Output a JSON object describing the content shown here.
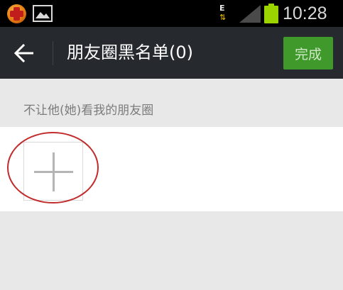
{
  "status_bar": {
    "time": "10:28",
    "data_indicator": "E",
    "icons": [
      "app-notification-icon",
      "gallery-icon",
      "data-transfer-icon",
      "signal-icon",
      "battery-icon"
    ]
  },
  "header": {
    "title": "朋友圈黑名单(0)",
    "done_label": "完成",
    "back_icon": "arrow-left-icon"
  },
  "section": {
    "label": "不让他(她)看我的朋友圈"
  },
  "members": {
    "add_icon": "plus-icon",
    "highlight_color": "#c22b2b"
  },
  "colors": {
    "title_bar": "#262a2e",
    "done_button": "#3f9a2b",
    "background": "#e8e8e8",
    "battery": "#9cd400"
  }
}
